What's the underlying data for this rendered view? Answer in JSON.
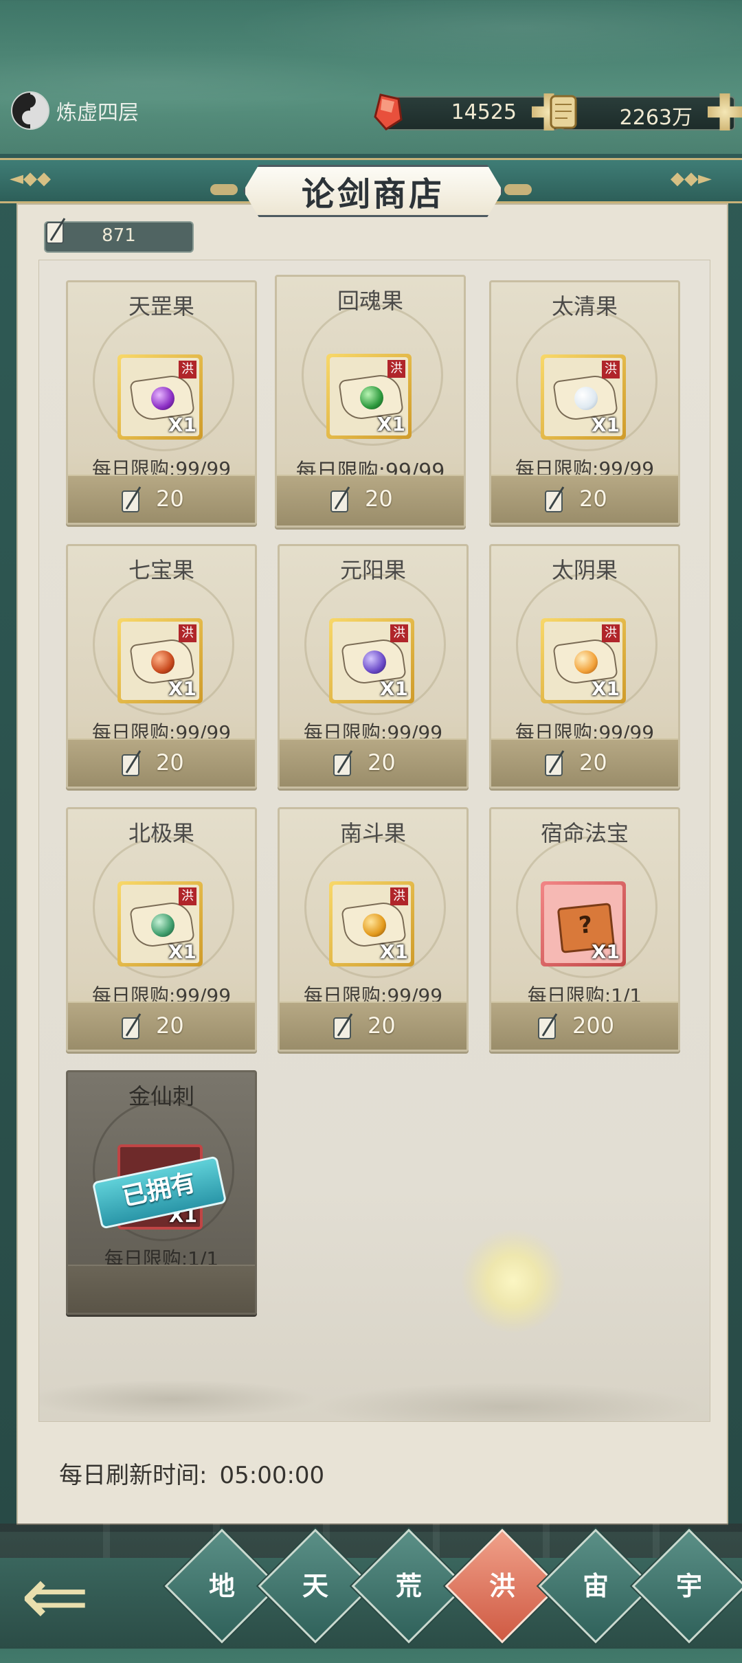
{
  "header": {
    "realm": "炼虚四层",
    "currencies": [
      {
        "name": "red-crystal",
        "value": "14525"
      },
      {
        "name": "scroll",
        "value": "2263万"
      }
    ]
  },
  "shop": {
    "title": "论剑商店",
    "token_balance": "871",
    "refresh_label": "每日刷新时间:",
    "refresh_time": "05:00:00",
    "owned_label": "已拥有"
  },
  "items": [
    {
      "name": "天罡果",
      "limit": "每日限购:99/99",
      "price": "20",
      "qty": "X1",
      "gem": "#8b2ec4"
    },
    {
      "name": "回魂果",
      "limit": "每日限购:99/99",
      "price": "20",
      "qty": "X1",
      "gem": "#2e9a3e"
    },
    {
      "name": "太清果",
      "limit": "每日限购:99/99",
      "price": "20",
      "qty": "X1",
      "gem": "#e6eef4"
    },
    {
      "name": "七宝果",
      "limit": "每日限购:99/99",
      "price": "20",
      "qty": "X1",
      "gem": "#c94a1e"
    },
    {
      "name": "元阳果",
      "limit": "每日限购:99/99",
      "price": "20",
      "qty": "X1",
      "gem": "#6a4ac8"
    },
    {
      "name": "太阴果",
      "limit": "每日限购:99/99",
      "price": "20",
      "qty": "X1",
      "gem": "#f2a23a"
    },
    {
      "name": "北极果",
      "limit": "每日限购:99/99",
      "price": "20",
      "qty": "X1",
      "gem": "#3f9d6c"
    },
    {
      "name": "南斗果",
      "limit": "每日限购:99/99",
      "price": "20",
      "qty": "X1",
      "gem": "#e39a1c"
    },
    {
      "name": "宿命法宝",
      "limit": "每日限购:1/1",
      "price": "200",
      "qty": "X1"
    },
    {
      "name": "金仙刺",
      "limit": "每日限购:1/1",
      "qty": "X1"
    }
  ],
  "nav": {
    "tabs": [
      "地",
      "天",
      "荒",
      "洪",
      "宙",
      "宇"
    ],
    "active": "洪"
  },
  "tag": "洪"
}
